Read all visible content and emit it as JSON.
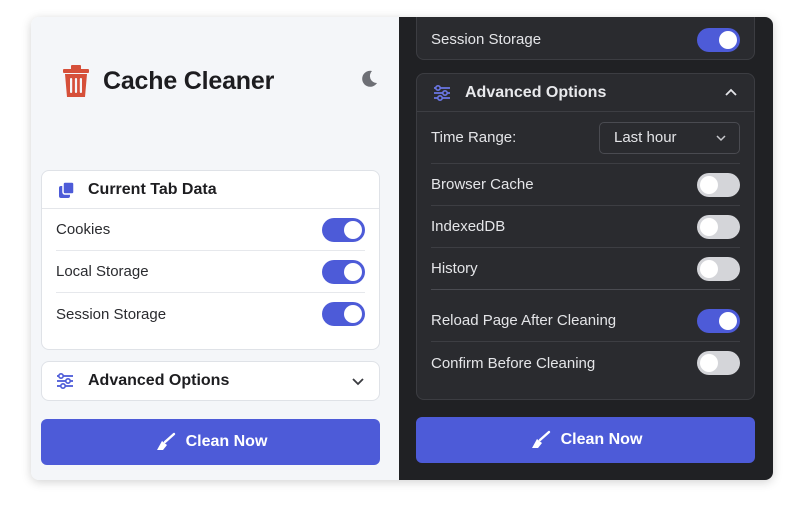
{
  "app": {
    "title": "Cache Cleaner"
  },
  "light": {
    "current_tab": {
      "title": "Current Tab Data",
      "items": [
        {
          "label": "Cookies",
          "on": true
        },
        {
          "label": "Local Storage",
          "on": true
        },
        {
          "label": "Session Storage",
          "on": true
        }
      ]
    },
    "advanced": {
      "title": "Advanced Options"
    },
    "clean_label": "Clean Now"
  },
  "dark": {
    "top_item": {
      "label": "Session Storage",
      "on": true
    },
    "advanced": {
      "title": "Advanced Options",
      "time_range_label": "Time Range:",
      "time_range_value": "Last hour",
      "items": [
        {
          "label": "Browser Cache",
          "on": false
        },
        {
          "label": "IndexedDB",
          "on": false
        },
        {
          "label": "History",
          "on": false
        }
      ],
      "behavior": [
        {
          "label": "Reload Page After Cleaning",
          "on": true
        },
        {
          "label": "Confirm Before Cleaning",
          "on": false
        }
      ]
    },
    "clean_label": "Clean Now"
  },
  "colors": {
    "accent": "#4d5bd8",
    "trash": "#d6503a",
    "dark_bg": "#202124",
    "light_bg": "#f4f6f9"
  },
  "icons": [
    "trash-icon",
    "moon-icon",
    "pages-icon",
    "sliders-icon",
    "chevron-down-icon",
    "chevron-up-icon",
    "broom-icon"
  ]
}
